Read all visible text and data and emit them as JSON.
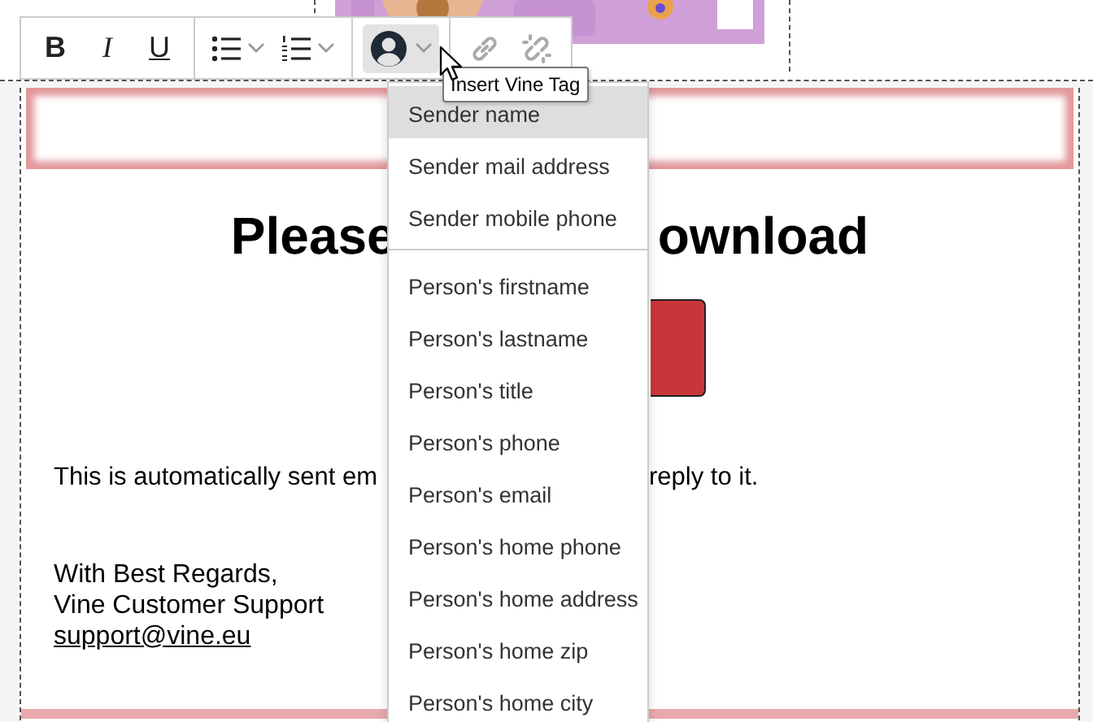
{
  "toolbar": {
    "groups": [
      [
        {
          "kind": "bold",
          "label": "B"
        },
        {
          "kind": "italic",
          "label": "I"
        },
        {
          "kind": "underline",
          "label": "U"
        }
      ],
      [
        {
          "kind": "bullet_list"
        },
        {
          "kind": "numbered_list"
        }
      ],
      [
        {
          "kind": "tag",
          "active": true
        }
      ],
      [
        {
          "kind": "link",
          "disabled": true
        },
        {
          "kind": "unlink",
          "disabled": true
        }
      ]
    ]
  },
  "tooltip": "Insert Vine Tag",
  "tag_menu": {
    "groups": [
      [
        {
          "label": "Sender name",
          "selected": true
        },
        {
          "label": "Sender mail address",
          "selected": false
        },
        {
          "label": "Sender mobile phone",
          "selected": false
        }
      ],
      [
        {
          "label": "Person's firstname",
          "selected": false
        },
        {
          "label": "Person's lastname",
          "selected": false
        },
        {
          "label": "Person's title",
          "selected": false
        },
        {
          "label": "Person's phone",
          "selected": false
        },
        {
          "label": "Person's email",
          "selected": false
        },
        {
          "label": "Person's home phone",
          "selected": false
        },
        {
          "label": "Person's home address",
          "selected": false
        },
        {
          "label": "Person's home zip",
          "selected": false
        },
        {
          "label": "Person's home city",
          "selected": false
        }
      ]
    ]
  },
  "email": {
    "header_image": {
      "kind": "picture"
    },
    "heading_parts": [
      "Please",
      "ownload"
    ],
    "body_parts": [
      "This is automatically sent em",
      "reply to it."
    ],
    "signature": [
      "With Best Regards,",
      "Vine Customer Support"
    ],
    "link": "support@vine.eu"
  }
}
